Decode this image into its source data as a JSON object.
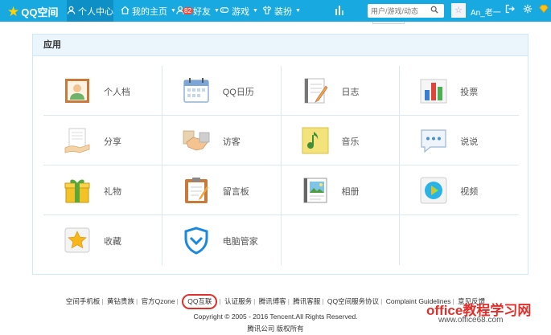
{
  "topbar": {
    "logo_text": "QQ空间",
    "nav": [
      {
        "label": "个人中心",
        "icon": "user-icon",
        "active": true
      },
      {
        "label": "我的主页",
        "icon": "home-icon",
        "caret": true
      },
      {
        "label": "好友",
        "icon": "friends-icon",
        "badge": "82",
        "caret": true
      },
      {
        "label": "游戏",
        "icon": "game-icon",
        "caret": true
      },
      {
        "label": "装扮",
        "icon": "shirt-icon",
        "caret": true
      }
    ],
    "search_placeholder": "用户/游戏/动态",
    "username": "An_老一",
    "accent_color": "#19a9e1"
  },
  "apps": {
    "title": "应用",
    "items": [
      {
        "label": "个人档",
        "icon": "profile-card-icon"
      },
      {
        "label": "QQ日历",
        "icon": "calendar-icon"
      },
      {
        "label": "日志",
        "icon": "blog-icon"
      },
      {
        "label": "投票",
        "icon": "vote-chart-icon"
      },
      {
        "label": "分享",
        "icon": "share-icon"
      },
      {
        "label": "访客",
        "icon": "handshake-icon"
      },
      {
        "label": "音乐",
        "icon": "music-icon"
      },
      {
        "label": "说说",
        "icon": "chat-bubble-icon"
      },
      {
        "label": "礼物",
        "icon": "gift-icon"
      },
      {
        "label": "留言板",
        "icon": "clipboard-icon"
      },
      {
        "label": "相册",
        "icon": "photo-album-icon"
      },
      {
        "label": "视频",
        "icon": "video-play-icon"
      },
      {
        "label": "收藏",
        "icon": "star-icon"
      },
      {
        "label": "电脑管家",
        "icon": "shield-icon"
      }
    ]
  },
  "footer": {
    "links": [
      "空间手机板",
      "黄钻贵族",
      "官方Qzone",
      "QQ互联",
      "认证服务",
      "腾讯博客",
      "腾讯客服",
      "QQ空间服务协议",
      "Complaint Guidelines",
      "意见反馈"
    ],
    "highlighted": "QQ互联",
    "copyright": "Copyright © 2005 - 2016 Tencent.All Rights Reserved.",
    "corp": "腾讯公司 版权所有"
  },
  "watermark": {
    "main": "office教程学习网",
    "url": "www.office68.com"
  }
}
